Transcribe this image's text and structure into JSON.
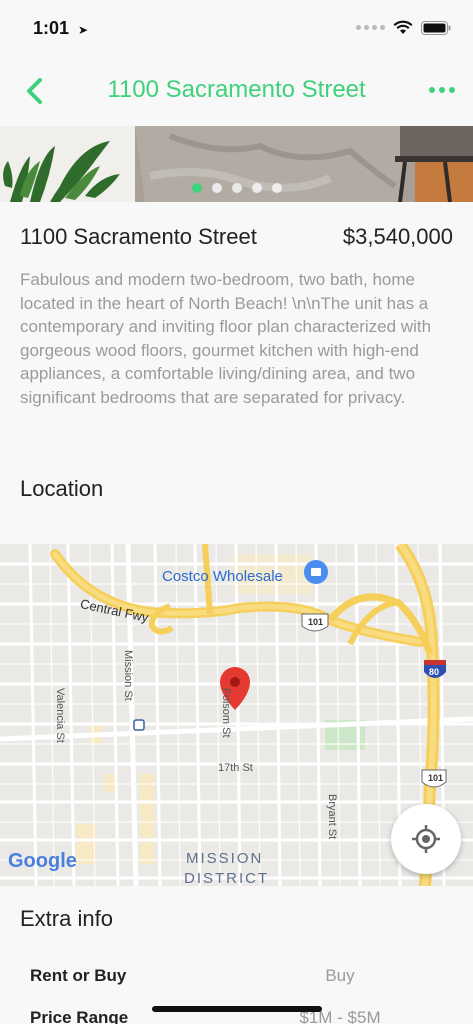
{
  "status": {
    "time": "1:01",
    "location_icon": "location-arrow-icon"
  },
  "nav": {
    "title": "1100 Sacramento Street",
    "back_icon": "chevron-left-icon",
    "more_icon": "more-dots-icon",
    "accent": "#3fd17b"
  },
  "gallery": {
    "image_count": 5,
    "active_index": 0
  },
  "listing": {
    "name": "1100 Sacramento Street",
    "price": "$3,540,000",
    "description": "Fabulous and modern two-bedroom, two bath, home located in the heart of North Beach! \\n\\nThe unit has a contemporary and inviting floor plan characterized with gorgeous wood floors, gourmet kitchen with high-end appliances, a comfortable living/dining area, and two significant bedrooms that are separated for privacy."
  },
  "location": {
    "section_title": "Location",
    "map_labels": {
      "costco": "Costco Wholesale",
      "central_fwy": "Central Fwy",
      "valencia": "Valencia St",
      "mission": "Mission St",
      "folsom": "Folsom St",
      "street17": "17th St",
      "bryant": "Bryant St",
      "district_line1": "MISSION",
      "district_line2": "DISTRICT",
      "us101": "101",
      "i80": "80",
      "google": "Google"
    }
  },
  "extra": {
    "section_title": "Extra info",
    "rows": [
      {
        "label": "Rent or Buy",
        "value": "Buy"
      },
      {
        "label": "Price Range",
        "value": "$1M - $5M"
      }
    ]
  }
}
